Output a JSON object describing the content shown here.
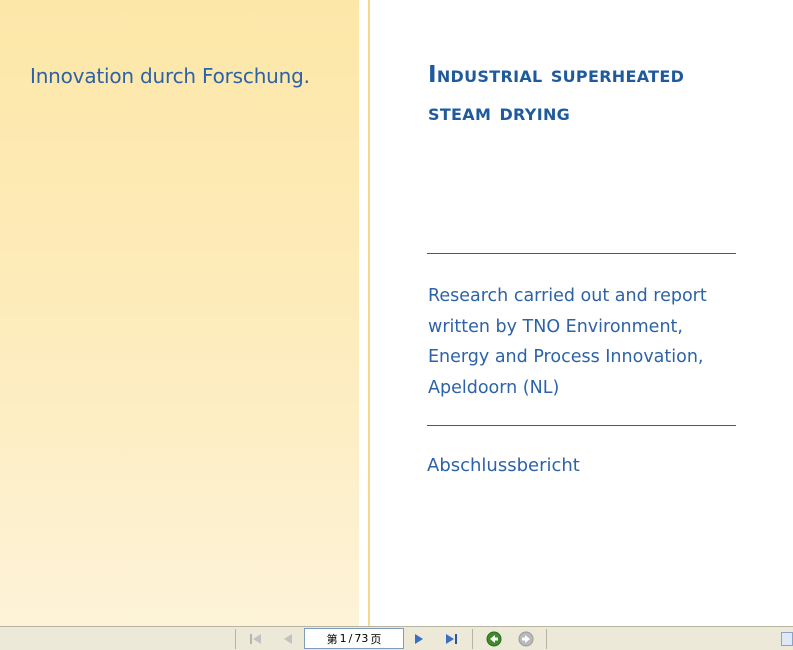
{
  "cover": {
    "tagline": "Innovation durch Forschung.",
    "title_line1": "Industrial superheated",
    "title_line2": "steam drying",
    "research_lines": [
      "Research carried out and report",
      "written by TNO Environment,",
      "Energy and Process Innovation,",
      "Apeldoorn (NL)"
    ],
    "report_type": "Abschlussbericht"
  },
  "toolbar": {
    "page_prefix": "第",
    "current_page": "1",
    "page_separator": "/",
    "total_pages": "73",
    "page_suffix": "页"
  },
  "colors": {
    "text_blue": "#2d63a6",
    "title_blue": "#1f5b9c",
    "panel_yellow": "#fde7a8",
    "toolbar_bg": "#ece9d8",
    "nav_green": "#3f8a2a"
  },
  "icons": {
    "first_page": "first-page-icon",
    "prev_page": "previous-page-icon",
    "next_page": "next-page-icon",
    "last_page": "last-page-icon",
    "back": "back-view-icon",
    "forward": "forward-view-icon"
  }
}
